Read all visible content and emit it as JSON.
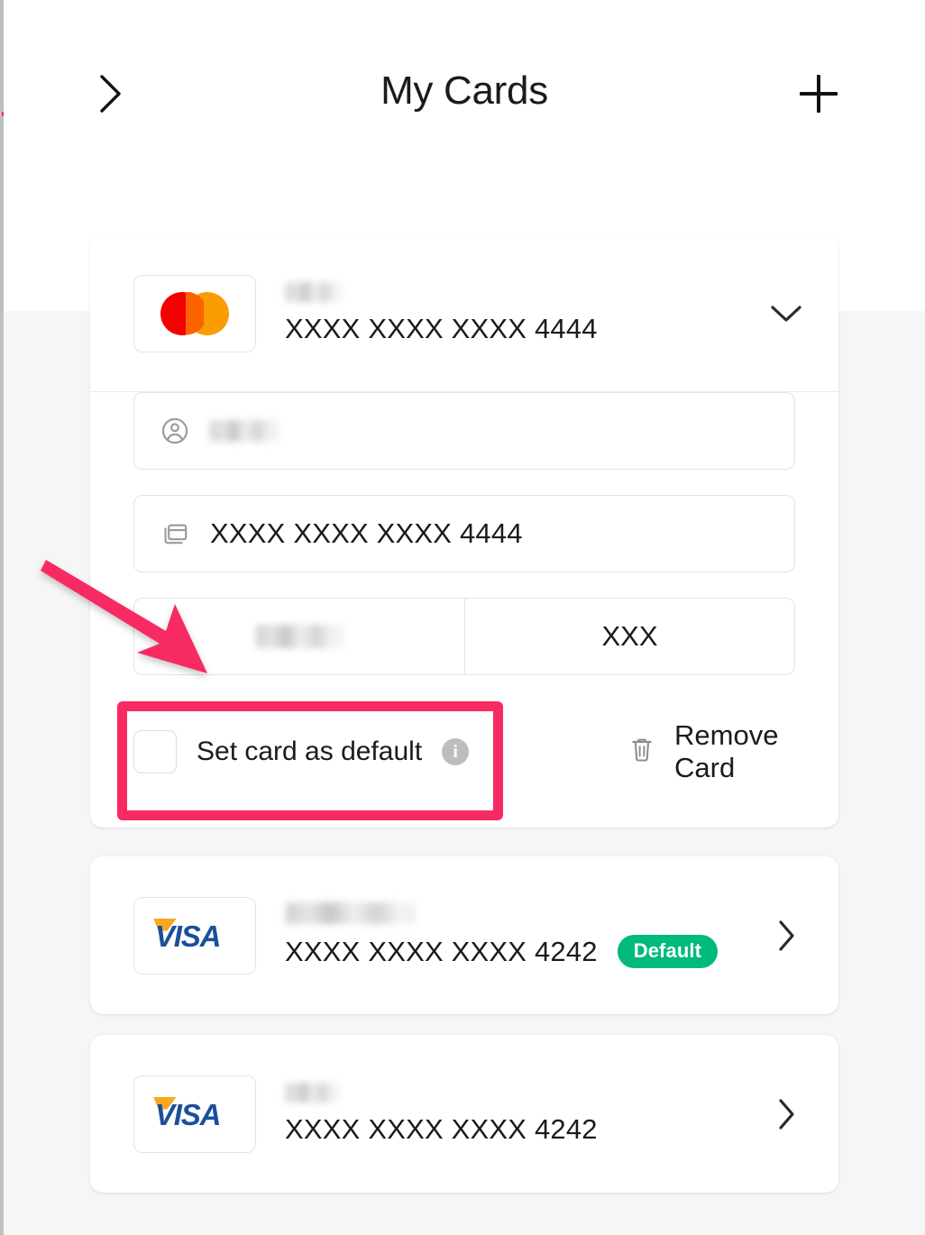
{
  "header": {
    "title": "My Cards",
    "back_icon": "chevron-right-icon",
    "add_icon": "plus-icon"
  },
  "colors": {
    "accent_pink": "#f72a62",
    "badge_green": "#00ba7c",
    "mastercard_red": "#f40000",
    "mastercard_yellow": "#fb9c04",
    "mastercard_overlap": "#fd6200",
    "visa_blue": "#1a4f9c",
    "visa_gold": "#f7a823",
    "page_background": "#f6f6f6",
    "panel_background": "#ffffff",
    "border_grey": "#e4e4e4",
    "text_primary": "#1b1b1b"
  },
  "cards": [
    {
      "brand": "mastercard",
      "brand_icon": "mastercard-icon",
      "label_redacted": true,
      "number": "XXXX XXXX XXXX 4444",
      "is_default": false,
      "badge": "",
      "expanded": true,
      "toggle_icon": "chevron-down-icon"
    },
    {
      "brand": "visa",
      "brand_icon": "visa-icon",
      "label_redacted": true,
      "number": "XXXX XXXX XXXX 4242",
      "is_default": true,
      "badge": "Default",
      "expanded": false,
      "toggle_icon": "chevron-right-icon"
    },
    {
      "brand": "visa",
      "brand_icon": "visa-icon",
      "label_redacted": true,
      "number": "XXXX XXXX XXXX 4242",
      "is_default": false,
      "badge": "",
      "expanded": false,
      "toggle_icon": "chevron-right-icon"
    }
  ],
  "detail": {
    "name_field": {
      "icon": "account-circle-icon",
      "value_redacted": true,
      "value": ""
    },
    "number_field": {
      "icon": "credit-card-icon",
      "value": "XXXX XXXX XXXX 4444"
    },
    "expiry_field": {
      "value_redacted": true,
      "value": ""
    },
    "cvv_field": {
      "value": "XXX"
    },
    "set_default": {
      "label": "Set card as default",
      "checked": false,
      "info_icon": "info-icon",
      "info_glyph": "i"
    },
    "remove_card": {
      "label": "Remove Card",
      "icon": "trash-icon"
    }
  },
  "annotations": {
    "highlight_target": "set-card-as-default-row",
    "arrow_target": "expiry-field"
  }
}
